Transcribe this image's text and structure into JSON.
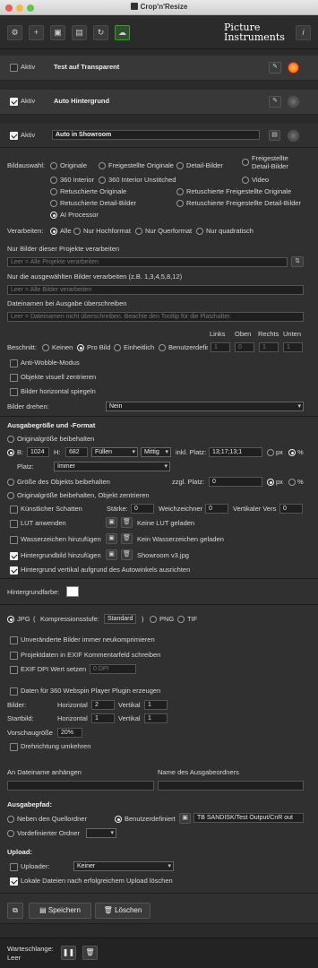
{
  "window": {
    "title": "Crop'n'Resize"
  },
  "brand": {
    "line1": "Picture",
    "line2": "Instruments"
  },
  "toolbar": {
    "icons": [
      "gear-icon",
      "plus-icon",
      "folder-icon",
      "save-icon",
      "refresh-icon",
      "cloud-upload-icon"
    ],
    "info_label": "i"
  },
  "panels": {
    "p1": {
      "active_label": "Aktiv",
      "title": "Test auf Transparent",
      "active": false
    },
    "p2": {
      "active_label": "Aktiv",
      "title": "Auto Hintergrund",
      "active": true
    },
    "p3": {
      "active_label": "Aktiv",
      "title": "Auto in Showroom",
      "active": true
    }
  },
  "bildauswahl": {
    "label": "Bildauswahl:",
    "options": [
      "Originale",
      "Freigestellte Originale",
      "Detail-Bilder",
      "Freigestellte Detail-Bilder",
      "360 Interior",
      "360 Interior Unstitched",
      "Video",
      "Retuschierte Originale",
      "Retuschierte Freigestellte Originale",
      "Retuschierte Detail-Bilder",
      "Retuschierte Freigestellte Detail-Bilder",
      "AI Processor"
    ],
    "selected": "AI Processor"
  },
  "verarbeiten": {
    "label": "Verarbeiten:",
    "options": [
      "Alle",
      "Nur Hochformat",
      "Nur Querformat",
      "Nur quadratisch"
    ],
    "selected": "Alle"
  },
  "projects": {
    "label": "Nur Bilder dieser Projekte verarbeiten",
    "placeholder": "Leer = Alle Projekte verarbeiten"
  },
  "selected_images": {
    "label": "Nur die ausgewählten Bilder verarbeiten (z.B. 1,3,4,5,8,12)",
    "placeholder": "Leer = Alle Bilder verarbeiten"
  },
  "filenames": {
    "label": "Dateinamen bei Ausgabe überschreiben",
    "placeholder": "Leer = Dateinamen nicht überschreiben. Beachte den Tooltip für die Platzhalter."
  },
  "crop": {
    "label": "Beschnitt:",
    "options": [
      "Keinen",
      "Pro Bild",
      "Einheitlich",
      "Benutzerdefini"
    ],
    "selected": "Pro Bild",
    "cols": [
      "Links",
      "Oben",
      "Rechts",
      "Unten"
    ],
    "values": [
      "1",
      "0",
      "1",
      "1"
    ]
  },
  "checks1": [
    {
      "label": "Anti-Wobble-Modus",
      "on": false
    },
    {
      "label": "Objekte visuell zentrieren",
      "on": false
    },
    {
      "label": "Bilder horizontal spiegeln",
      "on": false
    }
  ],
  "rotate": {
    "label": "Bilder drehen:",
    "value": "Nein"
  },
  "output": {
    "heading": "Ausgabegröße und -Format",
    "orig": "Originalgröße beibehalten",
    "b_label": "B:",
    "b_value": "1024",
    "h_label": "H:",
    "h_value": "682",
    "fill": "Füllen",
    "align": "Mittig",
    "inkl": "inkl. Platz:",
    "inkl_value": "13;17;13;1",
    "unit_px": "px",
    "unit_pct": "%",
    "platz_label": "Platz:",
    "platz_value": "Immer",
    "object_size": "Größe des Objekts beibehalten",
    "zzgl": "zzgl. Platz:",
    "zzgl_value": "0",
    "orig_center": "Originalgröße beibehalten, Objekt zentrieren"
  },
  "shadow": {
    "label": "Künstlicher Schatten",
    "staerke": "Stärke:",
    "staerke_value": "0",
    "weich": "Weichzeichner",
    "weich_value": "0",
    "vert": "Vertikaler Vers",
    "vert_value": "0"
  },
  "lut": {
    "label": "LUT anwenden",
    "status": "Keine LUT geladen"
  },
  "watermark": {
    "label": "Wasserzeichen hinzufügen",
    "status": "Kein Wasserzeichen geladen"
  },
  "background": {
    "label": "Hintergrundbild hinzufügen",
    "status": "Showroom v3.jpg"
  },
  "bg_align": {
    "label": "Hintergrund vertikal aufgrund des Autowinkels ausrichten"
  },
  "bgcolor": {
    "label": "Hintergrundfarbe:",
    "color": "#ffffff"
  },
  "format": {
    "jpg": "JPG",
    "kompr": "Kompressionsstufe:",
    "kompr_value": "Standard",
    "close": ")",
    "open": "(",
    "png": "PNG",
    "tif": "TIF",
    "selected": "JPG"
  },
  "checks2": [
    {
      "label": "Unveränderte Bilder immer neukomprimieren"
    },
    {
      "label": "Projektdaten in EXIF Kommentarfeld schreiben"
    },
    {
      "label": "EXIF DPI Wert setzen"
    }
  ],
  "dpi": {
    "placeholder": "0 DPI"
  },
  "webspin": {
    "label": "Daten für 360 Webspin Player Plugin erzeugen",
    "bilder": "Bilder:",
    "startbild": "Startbild:",
    "horizontal": "Horizontal",
    "vertikal": "Vertikal",
    "bilder_h": "2",
    "bilder_v": "1",
    "start_h": "1",
    "start_v": "1",
    "preview": "Vorschaugröße",
    "preview_value": "20%",
    "reverse": "Drehrichtung umkehren"
  },
  "append": {
    "label": "An Dateiname anhängen",
    "folder_label": "Name des Ausgabeordners"
  },
  "path": {
    "heading": "Ausgabepfad:",
    "next": "Neben den Quellordner",
    "custom": "Benutzerdefiniert",
    "custom_value": "TB SANDISK/Test Output/CnR out",
    "predefined": "Vordefinierter Ordner",
    "selected": "Benutzerdefiniert"
  },
  "upload": {
    "heading": "Upload:",
    "uploader": "Uploader:",
    "uploader_value": "Keiner",
    "delete": "Lokale Dateien nach erfolgreichem Upload löschen"
  },
  "buttons": {
    "save": "Speichern",
    "delete": "Löschen"
  },
  "queue": {
    "label": "Warteschlange:",
    "value": "Leer"
  }
}
